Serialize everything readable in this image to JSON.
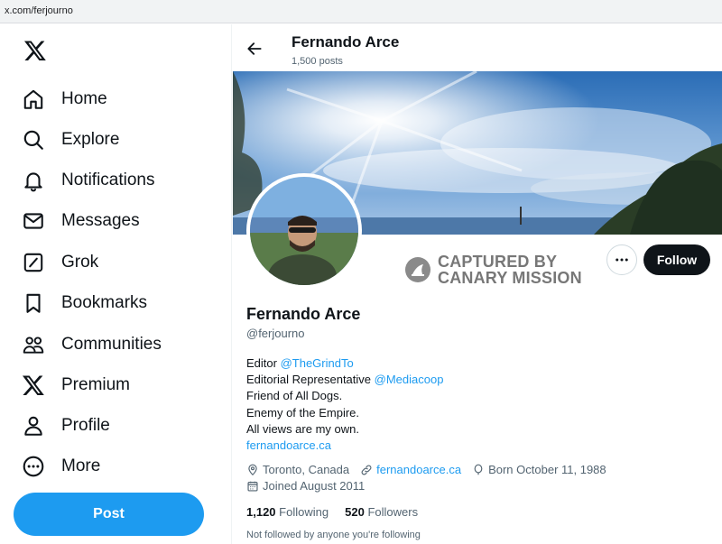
{
  "browser": {
    "url": "x.com/ferjourno"
  },
  "nav": {
    "items": [
      {
        "label": "Home",
        "icon": "home-icon"
      },
      {
        "label": "Explore",
        "icon": "search-icon"
      },
      {
        "label": "Notifications",
        "icon": "bell-icon"
      },
      {
        "label": "Messages",
        "icon": "envelope-icon"
      },
      {
        "label": "Grok",
        "icon": "grok-icon"
      },
      {
        "label": "Bookmarks",
        "icon": "bookmark-icon"
      },
      {
        "label": "Communities",
        "icon": "communities-icon"
      },
      {
        "label": "Premium",
        "icon": "x-logo-icon"
      },
      {
        "label": "Profile",
        "icon": "person-icon"
      },
      {
        "label": "More",
        "icon": "more-circle-icon"
      }
    ],
    "post_label": "Post"
  },
  "header": {
    "name": "Fernando Arce",
    "posts": "1,500 posts"
  },
  "watermark": {
    "line1": "CAPTURED BY",
    "line2": "CANARY MISSION"
  },
  "actions": {
    "follow_label": "Follow"
  },
  "profile": {
    "name": "Fernando Arce",
    "handle": "@ferjourno",
    "bio": {
      "l1_text": "Editor ",
      "l1_link": "@TheGrindTo",
      "l2_text": "Editorial Representative ",
      "l2_link": "@Mediacoop",
      "l3": "Friend of All Dogs.",
      "l4": "Enemy of the Empire.",
      "l5": "All views are my own.",
      "l6_link": "fernandoarce.ca"
    },
    "location": "Toronto, Canada",
    "website": "fernandoarce.ca",
    "born": "Born October 11, 1988",
    "joined": "Joined August 2011",
    "following_count": "1,120",
    "following_label": "Following",
    "followers_count": "520",
    "followers_label": "Followers",
    "not_followed": "Not followed by anyone you're following"
  },
  "colors": {
    "accent": "#1d9bf0",
    "text": "#0f1419",
    "muted": "#536471"
  }
}
